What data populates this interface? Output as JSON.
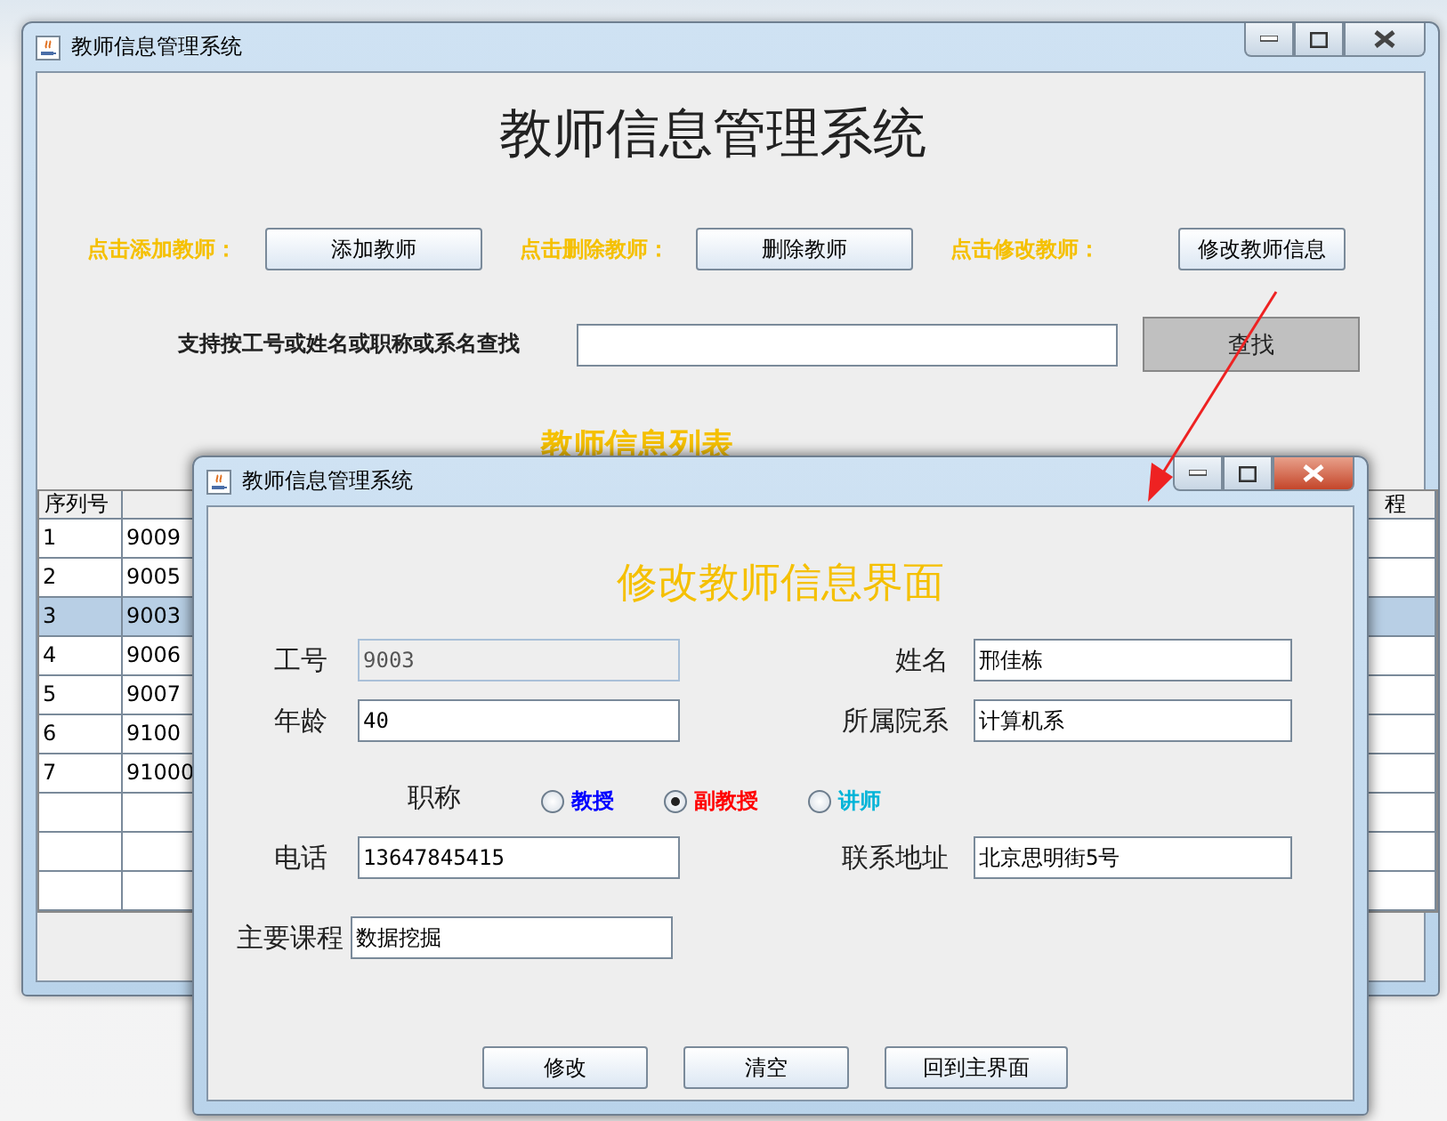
{
  "main_window": {
    "title": "教师信息管理系统",
    "heading": "教师信息管理系统",
    "actions": [
      {
        "label": "点击添加教师：",
        "button": "添加教师"
      },
      {
        "label": "点击删除教师：",
        "button": "删除教师"
      },
      {
        "label": "点击修改教师：",
        "button": "修改教师信息"
      }
    ],
    "search": {
      "label": "支持按工号或姓名或职称或系名查找",
      "button": "查找"
    },
    "list_heading": "教师信息列表",
    "table": {
      "first_column": "序列号",
      "last_column_fragment": "程",
      "rows": [
        {
          "number": "1",
          "id": "9009",
          "selected": false
        },
        {
          "number": "2",
          "id": "9005",
          "selected": false
        },
        {
          "number": "3",
          "id": "9003",
          "selected": true
        },
        {
          "number": "4",
          "id": "9006",
          "selected": false
        },
        {
          "number": "5",
          "id": "9007",
          "selected": false
        },
        {
          "number": "6",
          "id": "9100",
          "selected": false
        },
        {
          "number": "7",
          "id": "91000",
          "selected": false
        }
      ]
    }
  },
  "dialog": {
    "title": "教师信息管理系统",
    "heading": "修改教师信息界面",
    "fields": [
      {
        "label": "工号",
        "value": "9003",
        "disabled": true
      },
      {
        "label": "姓名",
        "value": "邢佳栋",
        "disabled": false
      },
      {
        "label": "年龄",
        "value": "40",
        "disabled": false
      },
      {
        "label": "所属院系",
        "value": "计算机系",
        "disabled": false
      }
    ],
    "title_label": "职称",
    "titles": [
      {
        "label": "教授",
        "color": "#0000ff",
        "selected": false
      },
      {
        "label": "副教授",
        "color": "#ff0000",
        "selected": true
      },
      {
        "label": "讲师",
        "color": "#00b4d8",
        "selected": false
      }
    ],
    "fields2": [
      {
        "label": "电话",
        "value": "13647845415",
        "disabled": false
      },
      {
        "label": "联系地址",
        "value": "北京思明街5号",
        "disabled": false
      }
    ],
    "course": {
      "label": "主要课程",
      "value": "数据挖掘"
    },
    "buttons": [
      "修改",
      "清空",
      "回到主界面"
    ]
  }
}
